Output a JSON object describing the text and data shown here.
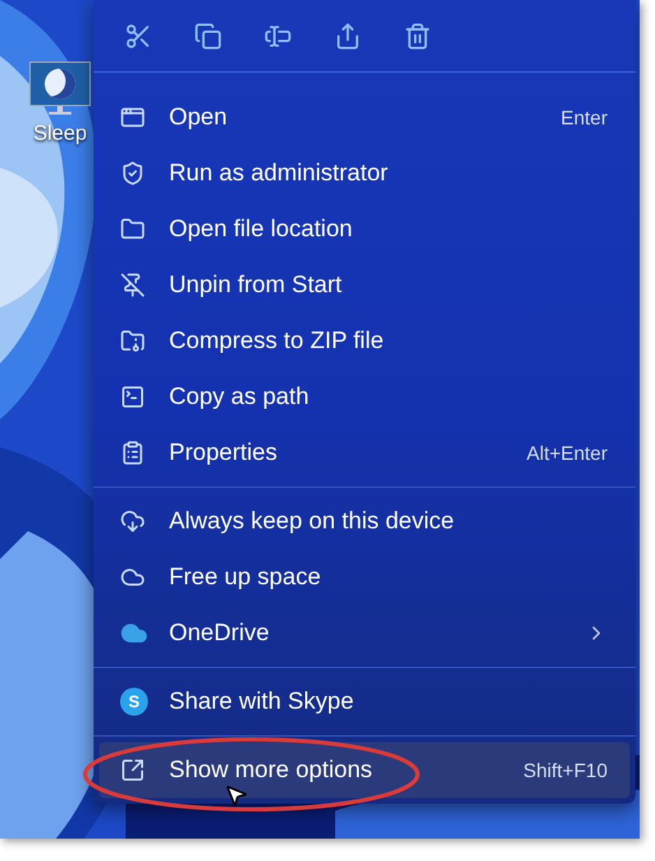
{
  "desktop_icons": [
    {
      "label": "Sleep"
    }
  ],
  "context_menu": {
    "sections": [
      {
        "items": [
          {
            "label": "Open",
            "shortcut": "Enter",
            "submenu": false,
            "highlighted": false
          },
          {
            "label": "Run as administrator",
            "submenu": false,
            "highlighted": false
          },
          {
            "label": "Open file location",
            "submenu": false,
            "highlighted": false
          },
          {
            "label": "Unpin from Start",
            "submenu": false,
            "highlighted": false
          },
          {
            "label": "Compress to ZIP file",
            "submenu": false,
            "highlighted": false
          },
          {
            "label": "Copy as path",
            "submenu": false,
            "highlighted": false
          },
          {
            "label": "Properties",
            "shortcut": "Alt+Enter",
            "submenu": false,
            "highlighted": false
          }
        ]
      },
      {
        "items": [
          {
            "label": "Always keep on this device",
            "submenu": false,
            "highlighted": false
          },
          {
            "label": "Free up space",
            "submenu": false,
            "highlighted": false
          },
          {
            "label": "OneDrive",
            "submenu": true,
            "highlighted": false
          }
        ]
      },
      {
        "items": [
          {
            "label": "Share with Skype",
            "logo_letter": "S",
            "submenu": false,
            "highlighted": false
          }
        ]
      },
      {
        "items": [
          {
            "label": "Show more options",
            "shortcut": "Shift+F10",
            "submenu": false,
            "highlighted": true
          }
        ]
      }
    ]
  }
}
